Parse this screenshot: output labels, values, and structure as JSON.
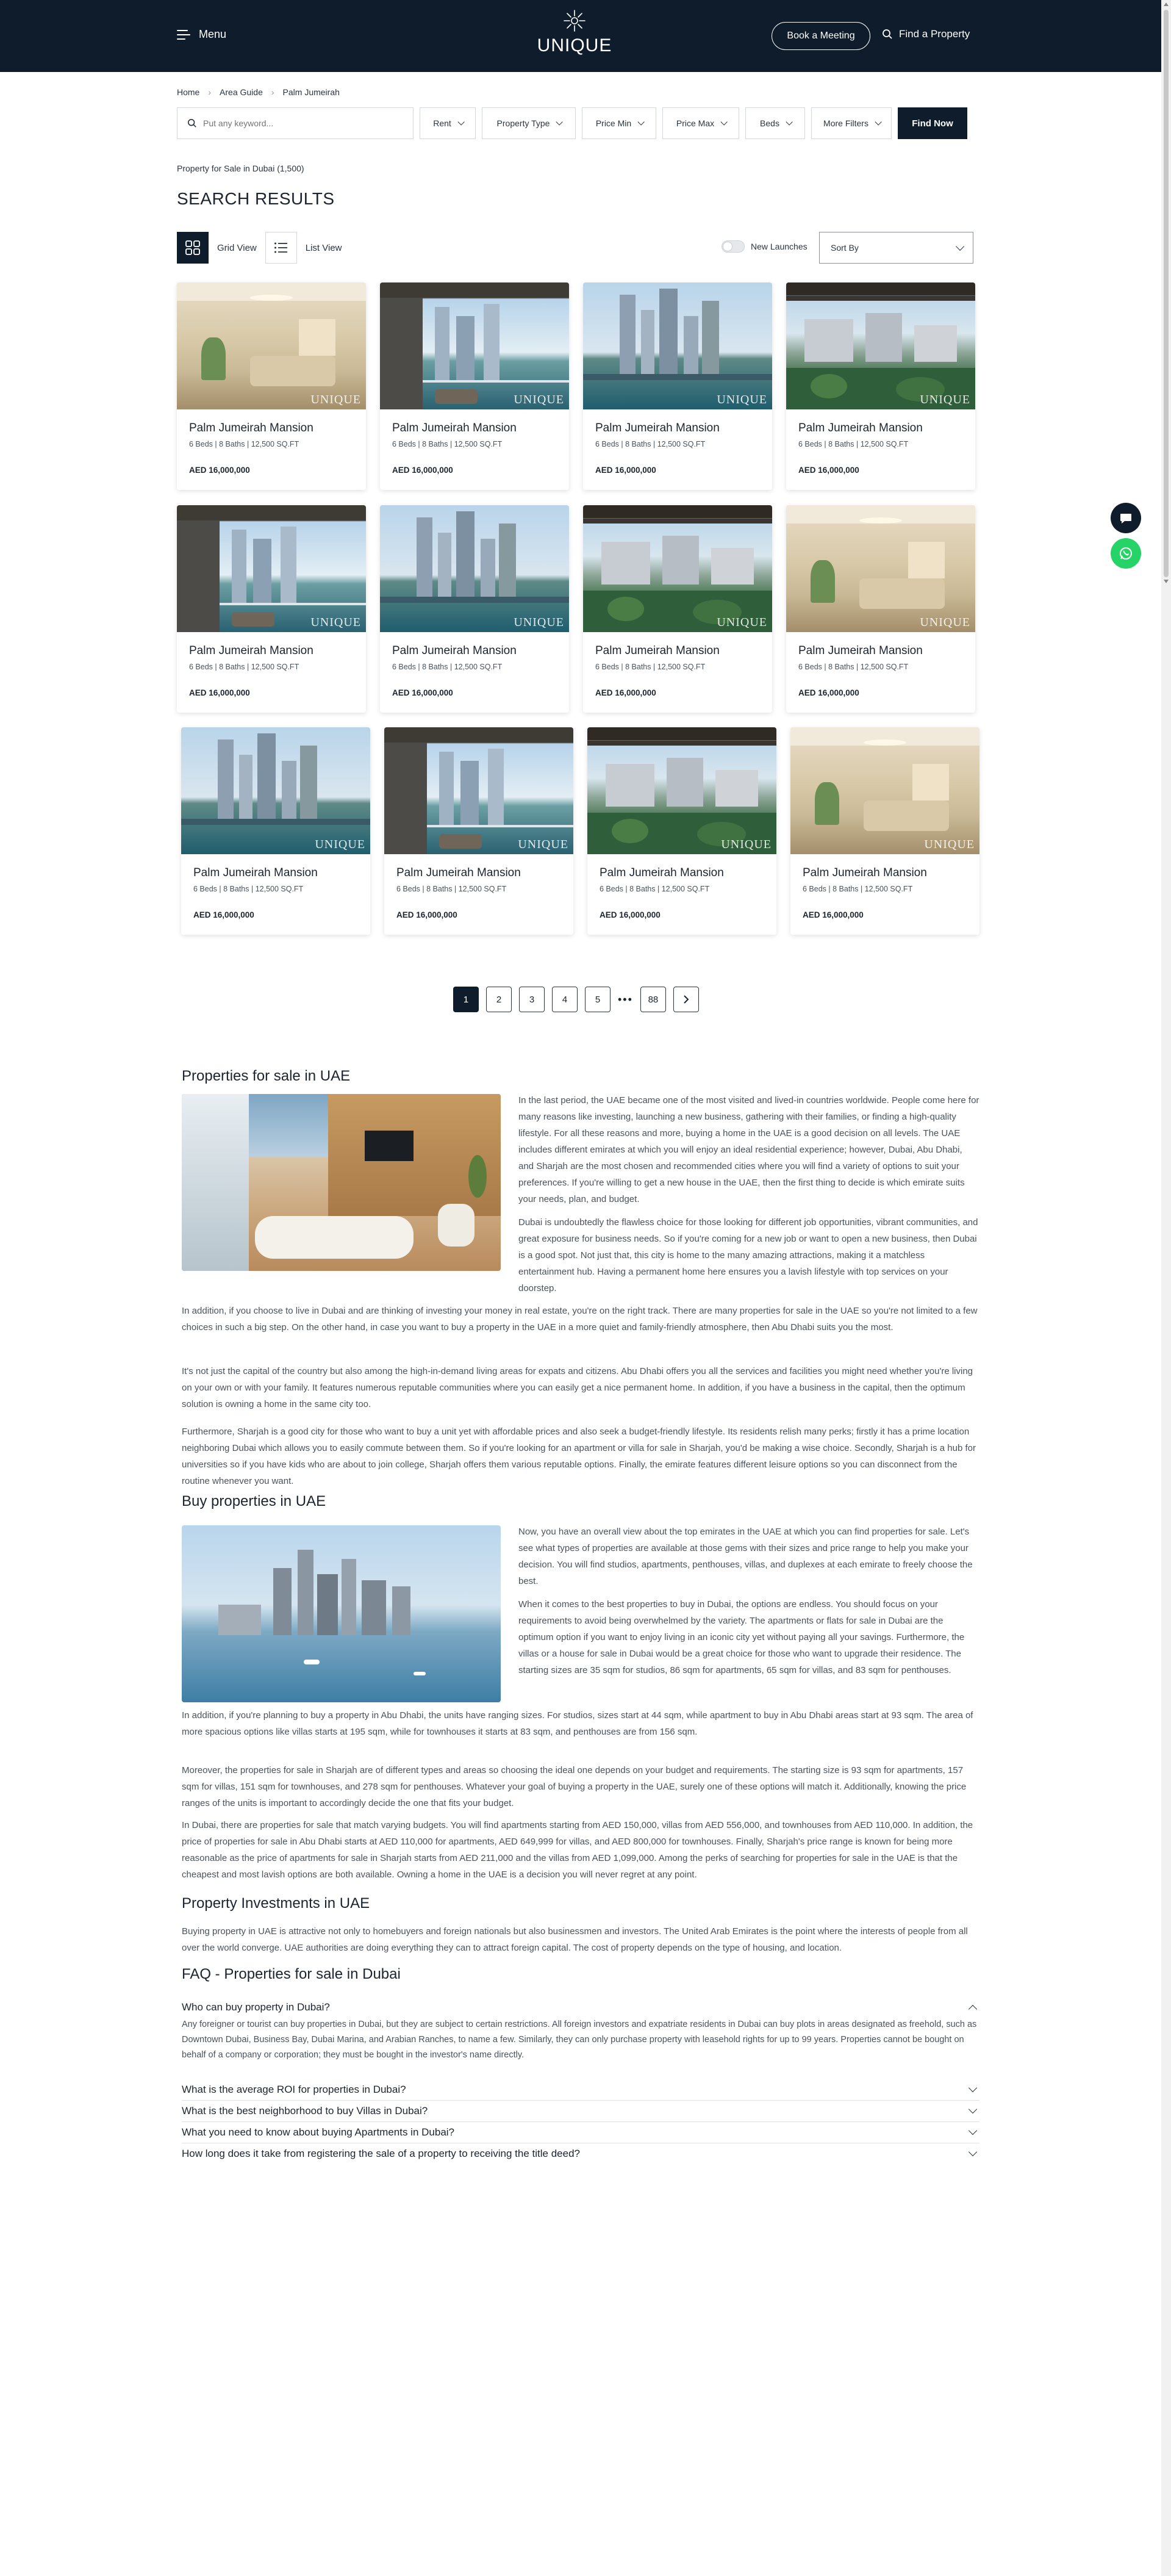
{
  "header": {
    "menu_label": "Menu",
    "logo_text": "UNIQUE",
    "book_label": "Book a Meeting",
    "find_label": "Find a Property"
  },
  "breadcrumb": [
    "Home",
    "Area Guide",
    "Palm Jumeirah"
  ],
  "search": {
    "placeholder": "Put any keyword...",
    "filters": [
      "Rent",
      "Property Type",
      "Price Min",
      "Price Max",
      "Beds",
      "More Filters"
    ],
    "find_label": "Find Now"
  },
  "results": {
    "count_text": "Property for Sale in Dubai (1,500)",
    "title": "SEARCH RESULTS",
    "grid_label": "Grid View",
    "list_label": "List View",
    "new_launches_label": "New Launches",
    "sort_label": "Sort By"
  },
  "listings": [
    {
      "title": "Palm Jumeirah Mansion",
      "specs": "6 Beds  |  8 Baths  |  12,500 SQ.FT",
      "price": "AED 16,000,000",
      "image": "interior",
      "watermark": "UNIQUE"
    },
    {
      "title": "Palm Jumeirah Mansion",
      "specs": "6 Beds  |  8 Baths  |  12,500 SQ.FT",
      "price": "AED 16,000,000",
      "image": "balcony",
      "watermark": "UNIQUE"
    },
    {
      "title": "Palm Jumeirah Mansion",
      "specs": "6 Beds  |  8 Baths  |  12,500 SQ.FT",
      "price": "AED 16,000,000",
      "image": "tower",
      "watermark": "UNIQUE"
    },
    {
      "title": "Palm Jumeirah Mansion",
      "specs": "6 Beds  |  8 Baths  |  12,500 SQ.FT",
      "price": "AED 16,000,000",
      "image": "green",
      "watermark": "UNIQUE"
    },
    {
      "title": "Palm Jumeirah Mansion",
      "specs": "6 Beds  |  8 Baths  |  12,500 SQ.FT",
      "price": "AED 16,000,000",
      "image": "balcony",
      "watermark": "UNIQUE"
    },
    {
      "title": "Palm Jumeirah Mansion",
      "specs": "6 Beds  |  8 Baths  |  12,500 SQ.FT",
      "price": "AED 16,000,000",
      "image": "tower",
      "watermark": "UNIQUE"
    },
    {
      "title": "Palm Jumeirah Mansion",
      "specs": "6 Beds  |  8 Baths  |  12,500 SQ.FT",
      "price": "AED 16,000,000",
      "image": "green",
      "watermark": "UNIQUE"
    },
    {
      "title": "Palm Jumeirah Mansion",
      "specs": "6 Beds  |  8 Baths  |  12,500 SQ.FT",
      "price": "AED 16,000,000",
      "image": "interior",
      "watermark": "UNIQUE"
    },
    {
      "title": "Palm Jumeirah Mansion",
      "specs": "6 Beds  |  8 Baths  |  12,500 SQ.FT",
      "price": "AED 16,000,000",
      "image": "tower",
      "watermark": "UNIQUE"
    },
    {
      "title": "Palm Jumeirah Mansion",
      "specs": "6 Beds  |  8 Baths  |  12,500 SQ.FT",
      "price": "AED 16,000,000",
      "image": "balcony",
      "watermark": "UNIQUE"
    },
    {
      "title": "Palm Jumeirah Mansion",
      "specs": "6 Beds  |  8 Baths  |  12,500 SQ.FT",
      "price": "AED 16,000,000",
      "image": "green",
      "watermark": "UNIQUE"
    },
    {
      "title": "Palm Jumeirah Mansion",
      "specs": "6 Beds  |  8 Baths  |  12,500 SQ.FT",
      "price": "AED 16,000,000",
      "image": "interior",
      "watermark": "UNIQUE"
    }
  ],
  "pagination": {
    "pages": [
      "1",
      "2",
      "3",
      "4",
      "5"
    ],
    "ellipsis": "•••",
    "last": "88",
    "current": "1"
  },
  "article": {
    "sale_title": "Properties for sale in UAE",
    "sale_p1": "In the last period, the UAE became one of the most visited and lived-in countries worldwide. People come here for many reasons like investing, launching a new business, gathering with their families, or finding a high-quality lifestyle. For all these reasons and more, buying a home in the UAE is a good decision on all levels. The UAE includes different emirates at which you will enjoy an ideal residential experience; however, Dubai, Abu Dhabi, and Sharjah are the most chosen and recommended cities where you will find a variety of options to suit your preferences. If you're willing to get a new house in the UAE, then the first thing to decide is which emirate suits your needs, plan, and budget.",
    "sale_p2": "Dubai is undoubtedly the flawless choice for those looking for different job opportunities, vibrant communities, and great exposure for business needs. So if you're coming for a new job or want to open a new business, then Dubai is a good spot. Not just that, this city is home to the many amazing attractions, making it a matchless entertainment hub. Having a permanent home here ensures you a lavish lifestyle with top services on your doorstep.",
    "sale_p3": "In addition, if you choose to live in Dubai and are thinking of investing your money in real estate, you're on the right track. There are many properties for sale in the UAE so you're not limited to a few choices in such a big step. On the other hand, in case you want to buy a property in the UAE in a more quiet and family-friendly atmosphere, then Abu Dhabi suits you the most.",
    "sale_p4": "It's not just the capital of the country but also among the high-in-demand living areas for expats and citizens. Abu Dhabi offers you all the services and facilities you might need whether you're living on your own or with your family. It features numerous reputable communities where you can easily get a nice permanent home. In addition, if you have a business in the capital, then the optimum solution is owning a home in the same city too.",
    "sale_p5": "Furthermore, Sharjah is a good city for those who want to buy a unit yet with affordable prices and also seek a budget-friendly lifestyle. Its residents relish many perks; firstly it has a prime location neighboring Dubai which allows you to easily commute between them. So if you're looking for an apartment or villa for sale in Sharjah, you'd be making a wise choice. Secondly, Sharjah is a hub for universities so if you have kids who are about to join college, Sharjah offers them various reputable options. Finally, the emirate features different leisure options so you can disconnect from the routine whenever you want.",
    "buy_title": "Buy properties in UAE",
    "buy_p1": "Now, you have an overall view about the top emirates in the UAE at which you can find properties for sale. Let's see what types of properties are available at those gems with their sizes and price range to help you make your decision. You will find studios, apartments, penthouses, villas, and duplexes at each emirate to freely choose the best.",
    "buy_p2": "When it comes to the best properties to buy in Dubai, the options are endless. You should focus on your requirements to avoid being overwhelmed by the variety. The apartments or flats for sale in Dubai are the optimum option if you want to enjoy living in an iconic city yet without paying all your savings. Furthermore, the villas or a house for sale in Dubai would be a great choice for those who want to upgrade their residence. The starting sizes are 35 sqm for studios, 86 sqm for apartments, 65 sqm for villas, and 83 sqm for penthouses.",
    "buy_p3": "In addition, if you're planning to buy a property in Abu Dhabi, the units have ranging sizes. For studios, sizes start at 44 sqm, while apartment to buy in Abu Dhabi areas start at 93 sqm. The area of more spacious options like villas starts at 195 sqm, while for townhouses it starts at 83 sqm, and penthouses are from 156 sqm.",
    "buy_p4": "Moreover, the properties for sale in Sharjah are of different types and areas so choosing the ideal one depends on your budget and requirements. The starting size is 93 sqm for apartments, 157 sqm for villas, 151 sqm for townhouses, and 278 sqm for penthouses. Whatever your goal of buying a property in the UAE, surely one of these options will match it. Additionally, knowing the price ranges of the units is important to accordingly decide the one that fits your budget.",
    "buy_p5": "In Dubai, there are properties for sale that match varying budgets. You will find apartments starting from AED 150,000, villas from AED 556,000, and townhouses from AED 110,000. In addition, the price of properties for sale in Abu Dhabi starts at AED 110,000 for apartments, AED 649,999 for villas, and AED 800,000 for townhouses. Finally, Sharjah's price range is known for being more reasonable as the price of apartments for sale in Sharjah starts from AED 211,000 and the villas from AED 1,099,000. Among the perks of searching for properties for sale in the UAE is that the cheapest and most lavish options are both available. Owning a home in the UAE is a decision you will never regret at any point.",
    "invest_title": "Property Investments in UAE",
    "invest_p1": "Buying property in UAE is attractive not only to homebuyers and foreign nationals but also businessmen and investors. The United Arab Emirates is the point where the interests of people from all over the world converge. UAE authorities are doing everything they can to attract foreign capital. The cost of property depends on the type of housing, and location."
  },
  "faq": {
    "title": "FAQ - Properties for sale in Dubai",
    "items": [
      {
        "q": "Who can buy property in Dubai?",
        "a": "Any foreigner or tourist can buy properties in Dubai, but they are subject to certain restrictions. All foreign investors and expatriate residents in Dubai can buy plots in areas designated as freehold, such as Downtown Dubai, Business Bay, Dubai Marina, and Arabian Ranches, to name a few. Similarly, they can only purchase property with leasehold rights for up to 99 years. Properties cannot be bought on behalf of a company or corporation; they must be bought in the investor's name directly."
      },
      {
        "q": "What is the average ROI for properties in Dubai?"
      },
      {
        "q": "What is the best neighborhood to buy Villas in Dubai?"
      },
      {
        "q": "What you need to know about buying Apartments in Dubai?"
      },
      {
        "q": "How long does it take from registering the sale of a property to receiving the title deed?"
      }
    ]
  },
  "colors": {
    "navy": "#0e1c2b",
    "whatsapp": "#25d366",
    "chat": "#0e1c2b"
  },
  "icons": [
    "hamburger-icon",
    "sunburst-logo-icon",
    "search-icon",
    "chevron-right-icon",
    "chevron-down-icon",
    "grid-icon",
    "list-icon",
    "chat-icon",
    "whatsapp-icon",
    "chevron-up-icon"
  ]
}
